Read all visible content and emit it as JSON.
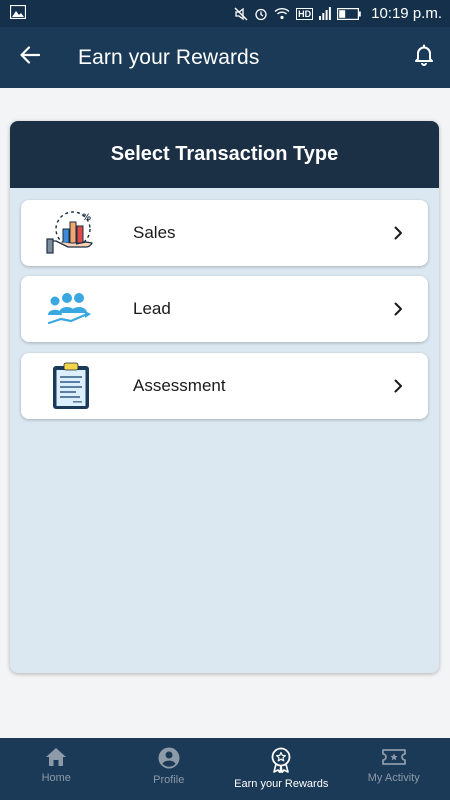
{
  "status_bar": {
    "time": "10:19 p.m.",
    "network_label": "HD"
  },
  "app_bar": {
    "title": "Earn your Rewards"
  },
  "card": {
    "title": "Select Transaction Type",
    "options": [
      {
        "label": "Sales",
        "icon": "sales-growth-icon"
      },
      {
        "label": "Lead",
        "icon": "lead-people-icon"
      },
      {
        "label": "Assessment",
        "icon": "clipboard-icon"
      }
    ]
  },
  "bottom_nav": {
    "items": [
      {
        "label": "Home",
        "icon": "home-icon",
        "active": false
      },
      {
        "label": "Profile",
        "icon": "profile-icon",
        "active": false
      },
      {
        "label": "Earn your Rewards",
        "icon": "reward-badge-icon",
        "active": true
      },
      {
        "label": "My Activity",
        "icon": "activity-ticket-icon",
        "active": false
      }
    ]
  },
  "colors": {
    "status_bar": "#14304a",
    "app_bar": "#1b3a57",
    "card_header": "#1b2f45",
    "card_body": "#dbe8f2",
    "nav_active": "#ffffff",
    "nav_inactive": "#8d9aa8"
  }
}
